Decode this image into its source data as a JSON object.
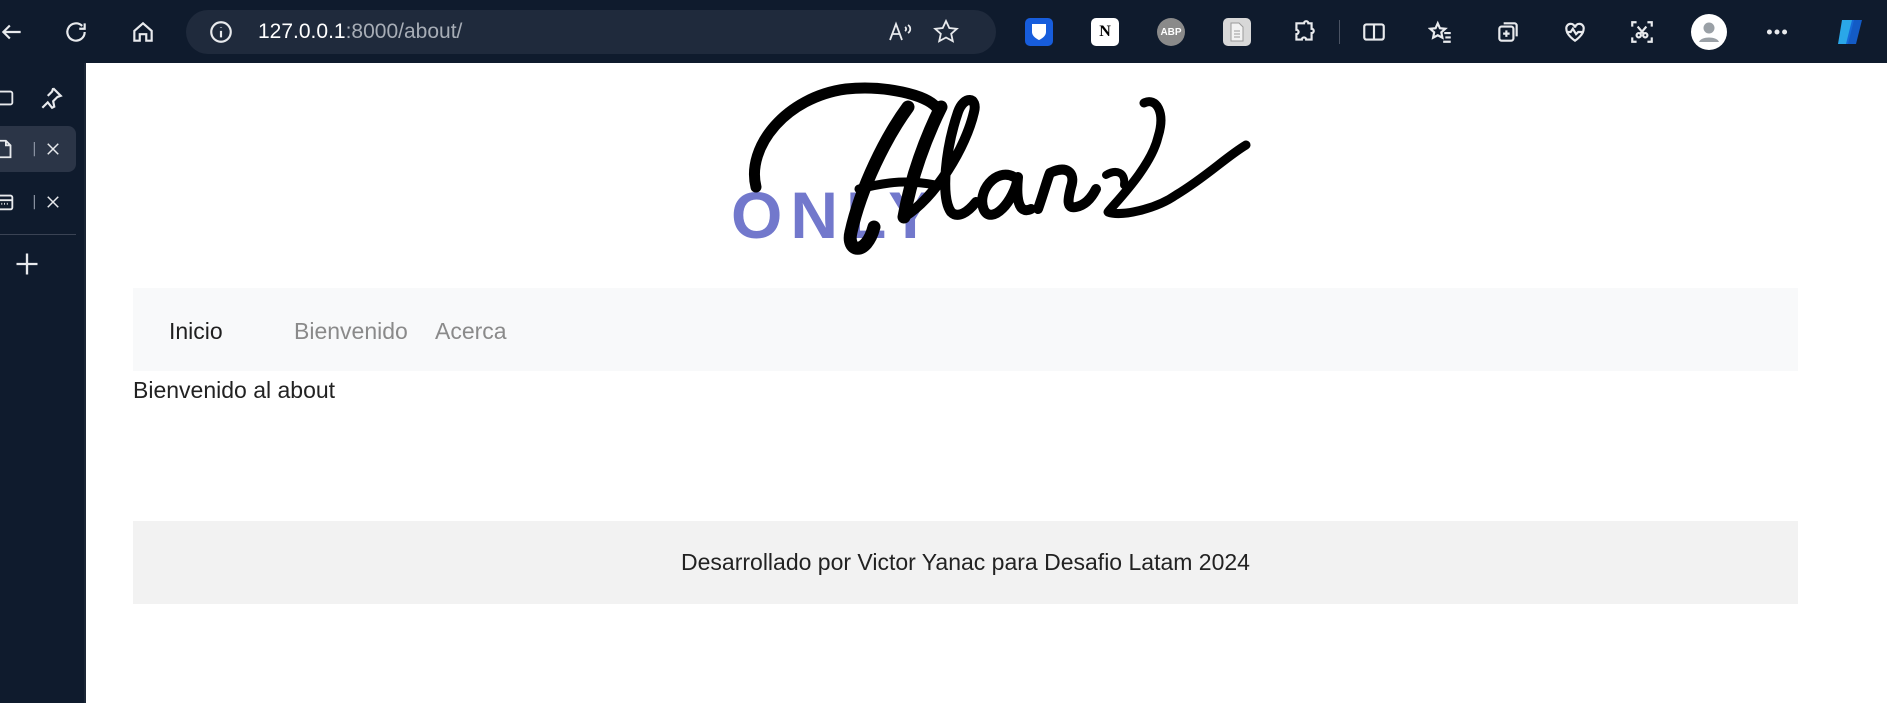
{
  "browser": {
    "url_host": "127.0.0.1",
    "url_path": ":8000/about/",
    "extensions": [
      {
        "name": "bitwarden-extension-icon",
        "label": ""
      },
      {
        "name": "notion-extension-icon",
        "label": "N"
      },
      {
        "name": "adblock-plus-extension-icon",
        "label": "ABP"
      },
      {
        "name": "document-extension-icon",
        "label": ""
      }
    ],
    "colors": {
      "toolbar": "#0f1b2d",
      "address_bar": "#1f2a3c"
    }
  },
  "logo": {
    "prefix": "ONLY",
    "wordmark": "Flans",
    "prefix_color": "#7278cc"
  },
  "nav": {
    "items": [
      {
        "label": "Inicio",
        "active": true
      },
      {
        "label": "Bienvenido",
        "active": false
      },
      {
        "label": "Acerca",
        "active": false
      }
    ]
  },
  "main": {
    "text": "Bienvenido al about"
  },
  "footer": {
    "text": "Desarrollado por Victor Yanac para Desafio Latam 2024"
  }
}
